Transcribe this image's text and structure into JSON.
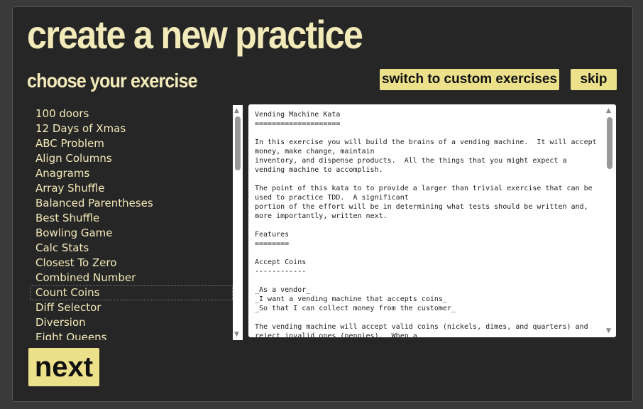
{
  "title": "create a new practice",
  "subtitle": "choose your exercise",
  "buttons": {
    "custom": "switch to custom exercises",
    "skip": "skip",
    "next": "next"
  },
  "exercises": [
    "100 doors",
    "12 Days of Xmas",
    "ABC Problem",
    "Align Columns",
    "Anagrams",
    "Array Shuffle",
    "Balanced Parentheses",
    "Best Shuffle",
    "Bowling Game",
    "Calc Stats",
    "Closest To Zero",
    "Combined Number",
    "Count Coins",
    "Diff Selector",
    "Diversion",
    "Eight Queens"
  ],
  "selected": "Vending Machine",
  "description": "Vending Machine Kata\n====================\n\nIn this exercise you will build the brains of a vending machine.  It will accept money, make change, maintain\ninventory, and dispense products.  All the things that you might expect a vending machine to accomplish.\n\nThe point of this kata to to provide a larger than trivial exercise that can be used to practice TDD.  A significant\nportion of the effort will be in determining what tests should be written and, more importantly, written next.\n\nFeatures\n========\n\nAccept Coins\n------------\n\n_As a vendor_\n_I want a vending machine that accepts coins_\n_So that I can collect money from the customer_\n\nThe vending machine will accept valid coins (nickels, dimes, and quarters) and reject invalid ones (pennies).  When a"
}
